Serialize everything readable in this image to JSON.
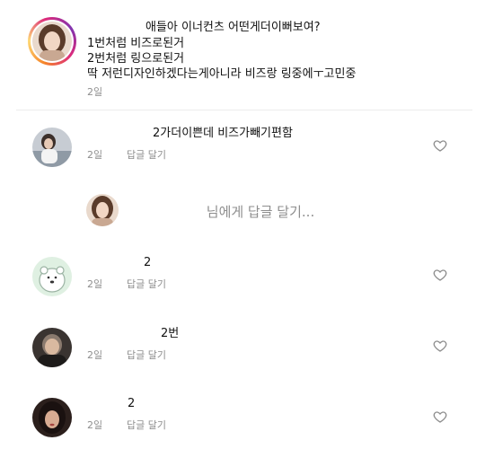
{
  "post": {
    "lines": [
      "애들아 이너컨츠 어떤게더이뻐보여?",
      "1번처럼 비즈로된거",
      "2번처럼 링으로된거",
      "딱 저런디자인하겠다는게아니라 비즈랑 링중에ㅜ고민중"
    ],
    "time": "2일"
  },
  "comments": [
    {
      "text": "2가더이쁜데 비즈가빼기편함",
      "time": "2일",
      "reply_label": "답글 달기",
      "avatar_icon": "person-photo"
    },
    {
      "text": "2",
      "time": "2일",
      "reply_label": "답글 달기",
      "avatar_icon": "bear-illustration"
    },
    {
      "text": "2번",
      "time": "2일",
      "reply_label": "답글 달기",
      "avatar_icon": "person-photo"
    },
    {
      "text": "2",
      "time": "2일",
      "reply_label": "답글 달기",
      "avatar_icon": "person-photo"
    }
  ],
  "reply_composer": {
    "placeholder": "님에게 답글 달기..."
  },
  "icons": {
    "like": "heart-outline-icon"
  },
  "colors": {
    "text": "#111111",
    "meta": "#8e8e8e",
    "divider": "#ececec",
    "story_ring": [
      "#f58529",
      "#dd2a7b",
      "#8134af"
    ]
  }
}
